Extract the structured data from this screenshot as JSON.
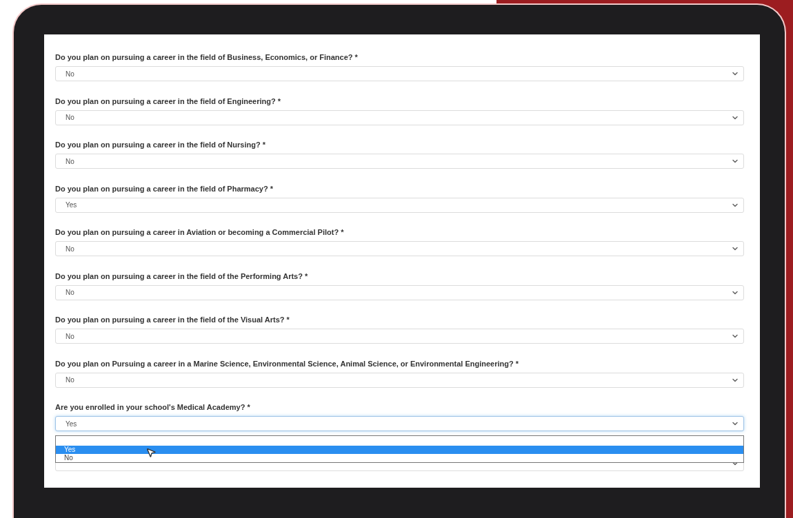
{
  "questions": [
    {
      "label": "Do you plan on pursuing a career in the field of Business, Economics, or Finance? *",
      "value": "No",
      "open": false
    },
    {
      "label": "Do you plan on pursuing a career in the field of Engineering? *",
      "value": "No",
      "open": false
    },
    {
      "label": "Do you plan on pursuing a career in the field of Nursing? *",
      "value": "No",
      "open": false
    },
    {
      "label": "Do you plan on pursuing a career in the field of Pharmacy? *",
      "value": "Yes",
      "open": false
    },
    {
      "label": "Do you plan on pursuing a career in Aviation or becoming a Commercial Pilot? *",
      "value": "No",
      "open": false
    },
    {
      "label": "Do you plan on pursuing a career in the field of the Performing Arts? *",
      "value": "No",
      "open": false
    },
    {
      "label": "Do you plan on pursuing a career in the field of the Visual Arts? *",
      "value": "No",
      "open": false
    },
    {
      "label": "Do you plan on Pursuing a career in a Marine Science, Environmental Science, Animal Science, or Environmental Engineering? *",
      "value": "No",
      "open": false
    },
    {
      "label": "Are you enrolled in your school's Medical Academy? *",
      "value": "Yes",
      "open": true,
      "options": [
        {
          "label": "Yes",
          "selected": true
        },
        {
          "label": "No",
          "selected": false
        }
      ]
    }
  ]
}
